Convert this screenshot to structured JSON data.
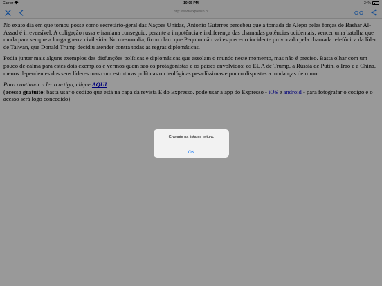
{
  "status_bar": {
    "carrier": "Carrier",
    "time": "10:05 PM",
    "battery_percent": "34%",
    "battery_level": 0.34
  },
  "toolbar": {
    "url": "http://www.expresso.pt"
  },
  "article": {
    "p1": "No exato dia em que tomou posse como secretário-geral das Nações Unidas, António Guterres percebeu que a tomada de Alepo pelas forças de Bashar Al-Assad é irreversível. A coligação russa e iraniana conseguiu, perante a impotência e indiferença das chamadas potências ocidentais, vencer uma batalha que muda para sempre a longa guerra civil síria. No mesmo dia, ficou claro que Pequim não vai esquecer o incidente provocado pela chamada telefónica da líder de Taiwan, que Donald Trump decidiu atender contra todas as regras diplomáticas.",
    "p2": "Podia juntar mais alguns exemplos das disfunções políticas e diplomáticas que assolam o mundo neste momento, mas não é preciso. Basta olhar com um pouco de calma para estes dois exemplos e vermos quem são os protagonistas e os países envolvidos: os EUA de Trump, a Rússia de Putin, o Irão e a China, menos dependentes dos seus líderes mas com estruturas políticas ou teológicas pesadíssimas e pouco dispostas a mudanças de rumo.",
    "continue_text": "Para continuar a ler o artigo, clique ",
    "continue_link": "AQUI",
    "free_access_label": "acesso gratuito",
    "free_access_text": ": basta usar o código que está na capa da revista E do Expresso. pode usar a app do Expresso - ",
    "ios_link": "iOS",
    "conjunction": " e ",
    "android_link": "android",
    "free_access_end": " - para fotografar o código e o acesso será logo concedido)"
  },
  "alert": {
    "message": "Gravado na lista de leitura.",
    "ok_label": "OK"
  },
  "colors": {
    "link": "#0000cc",
    "accent": "#1a7cf5"
  },
  "icons": {
    "close": "close-icon",
    "back": "chevron-left-icon",
    "reading_list": "reading-list-glasses-icon",
    "share": "share-icon",
    "wifi": "wifi-icon"
  }
}
